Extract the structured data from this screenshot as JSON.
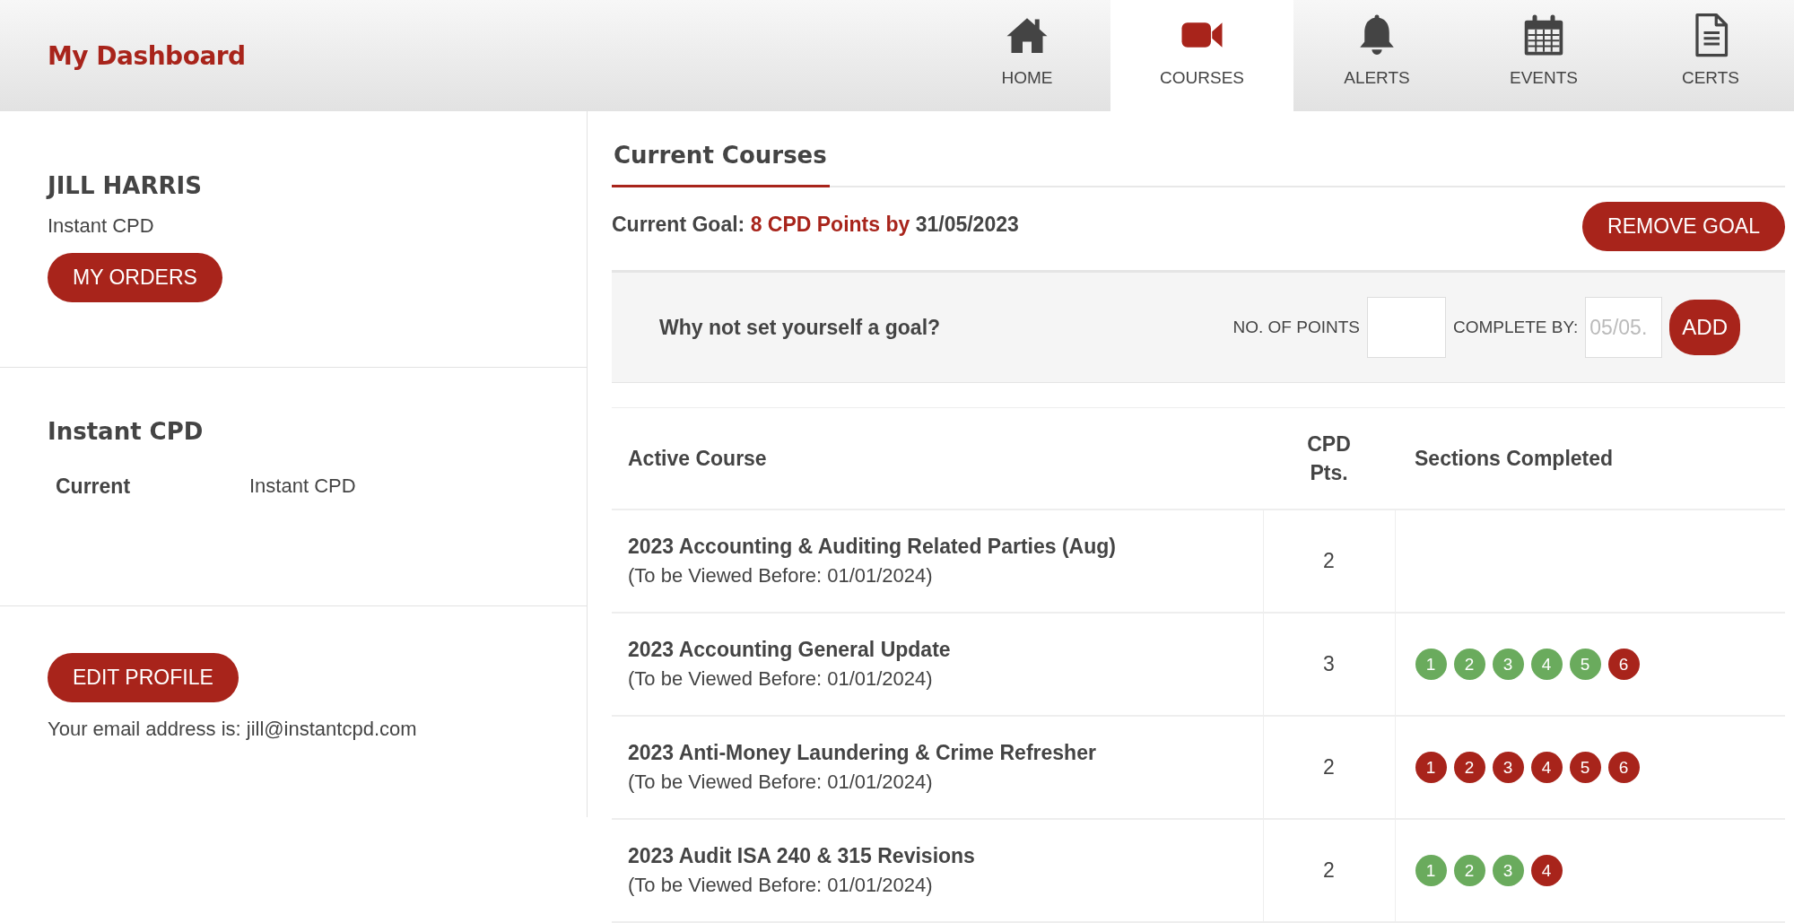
{
  "header": {
    "title": "My Dashboard"
  },
  "nav": [
    {
      "label": "HOME",
      "kind": "home",
      "selected": false
    },
    {
      "label": "COURSES",
      "kind": "courses",
      "selected": true
    },
    {
      "label": "ALERTS",
      "kind": "alerts",
      "selected": false
    },
    {
      "label": "EVENTS",
      "kind": "events",
      "selected": false
    },
    {
      "label": "CERTS",
      "kind": "certs",
      "selected": false
    }
  ],
  "profile": {
    "name": "JILL HARRIS",
    "company": "Instant CPD",
    "orders_button": "MY ORDERS"
  },
  "subscription": {
    "title": "Instant CPD",
    "label": "Current",
    "value": "Instant CPD"
  },
  "account": {
    "edit_button": "EDIT PROFILE",
    "email_text": "Your email address is: jill@instantcpd.com"
  },
  "courses": {
    "tab": "Current Courses",
    "goal": {
      "label": "Current Goal:",
      "target": "8 CPD Points by",
      "date": "31/05/2023",
      "remove_button": "REMOVE GOAL"
    },
    "goal_form": {
      "prompt": "Why not set yourself a goal?",
      "points_label": "NO. OF POINTS",
      "date_label": "COMPLETE BY:",
      "date_placeholder": "05/05.",
      "add_button": "ADD"
    },
    "columns": [
      "Active Course",
      "CPD Pts.",
      "Sections Completed"
    ],
    "rows": [
      {
        "title": "2023 Accounting & Auditing Related Parties (Aug)",
        "deadline": "(To be Viewed Before: 01/01/2024)",
        "points": "2",
        "sections": []
      },
      {
        "title": "2023 Accounting General Update",
        "deadline": "(To be Viewed Before: 01/01/2024)",
        "points": "3",
        "sections": [
          {
            "label": "1",
            "completed": true
          },
          {
            "label": "2",
            "completed": true
          },
          {
            "label": "3",
            "completed": true
          },
          {
            "label": "4",
            "completed": true
          },
          {
            "label": "5",
            "completed": true
          },
          {
            "label": "6",
            "completed": false
          }
        ]
      },
      {
        "title": "2023 Anti-Money Laundering & Crime Refresher",
        "deadline": "(To be Viewed Before: 01/01/2024)",
        "points": "2",
        "sections": [
          {
            "label": "1",
            "completed": false
          },
          {
            "label": "2",
            "completed": false
          },
          {
            "label": "3",
            "completed": false
          },
          {
            "label": "4",
            "completed": false
          },
          {
            "label": "5",
            "completed": false
          },
          {
            "label": "6",
            "completed": false
          }
        ]
      },
      {
        "title": "2023 Audit ISA 240 & 315 Revisions",
        "deadline": "(To be Viewed Before: 01/01/2024)",
        "points": "2",
        "sections": [
          {
            "label": "1",
            "completed": true
          },
          {
            "label": "2",
            "completed": true
          },
          {
            "label": "3",
            "completed": true
          },
          {
            "label": "4",
            "completed": false
          }
        ]
      }
    ]
  }
}
